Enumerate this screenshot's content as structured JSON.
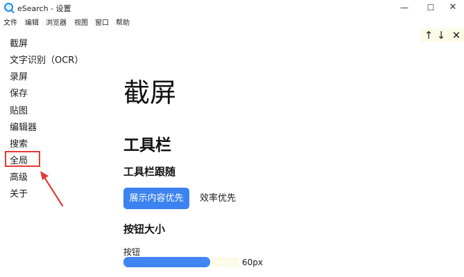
{
  "window": {
    "title": "eSearch - 设置",
    "minimize": "—",
    "maximize": "☐",
    "close": "✕"
  },
  "menu": [
    "文件",
    "编辑",
    "浏览器",
    "视图",
    "窗口",
    "帮助"
  ],
  "sidebar": {
    "items": [
      "截屏",
      "文字识别（OCR）",
      "录屏",
      "保存",
      "贴图",
      "编辑器",
      "搜索",
      "全局",
      "高级",
      "关于"
    ],
    "highlighted_index": 7
  },
  "nav": {
    "up": "↑",
    "down": "↓",
    "close": "✕"
  },
  "main": {
    "page_title": "截屏",
    "section_title": "工具栏",
    "follow": {
      "title": "工具栏跟随",
      "options": [
        "展示内容优先",
        "效率优先"
      ],
      "selected": "展示内容优先"
    },
    "button_size": {
      "title": "按钮大小",
      "field_label": "按钮",
      "value_text": "60px",
      "fill_fraction": 0.75
    }
  },
  "colors": {
    "accent": "#3c82f0",
    "highlight": "#e53935",
    "track": "#fbfbe8"
  }
}
